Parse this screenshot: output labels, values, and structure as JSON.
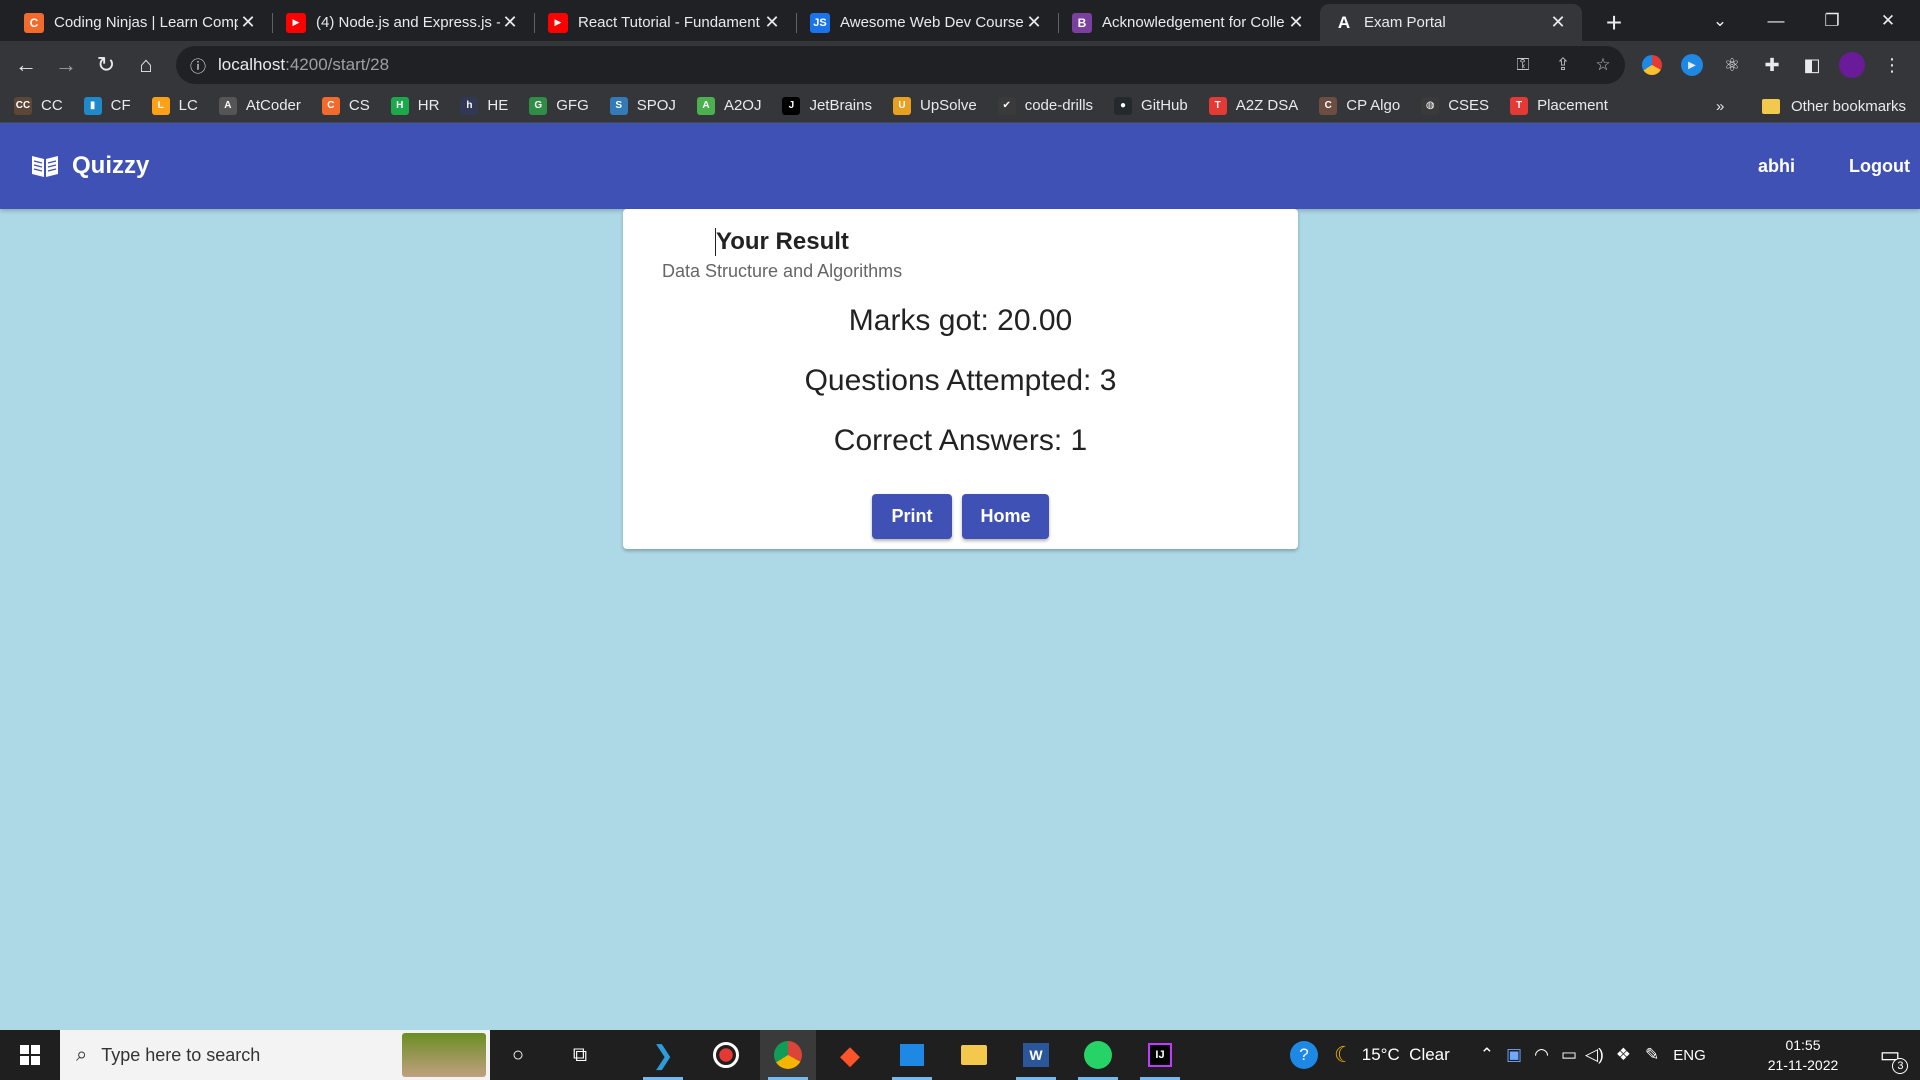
{
  "browser": {
    "tabs": [
      {
        "title": "Coding Ninjas | Learn Comp",
        "icon": "coding-ninjas-icon",
        "color": "#f36b2c"
      },
      {
        "title": "(4) Node.js and Express.js -",
        "icon": "youtube-icon",
        "color": "#ff0000"
      },
      {
        "title": "React Tutorial - Fundament",
        "icon": "youtube-icon",
        "color": "#ff0000"
      },
      {
        "title": "Awesome Web Dev Course",
        "icon": "js-icon",
        "color": "#1a73e8"
      },
      {
        "title": "Acknowledgement for Colle",
        "icon": "document-icon",
        "color": "#7b3fa0"
      },
      {
        "title": "Exam Portal",
        "icon": "angular-icon",
        "color": "#35363a"
      }
    ],
    "url_host": "localhost",
    "url_path": ":4200/start/28",
    "bookmarks": [
      {
        "label": "CC",
        "icon": "codechef-icon",
        "color": "#5b4638",
        "glyph": "CC"
      },
      {
        "label": "CF",
        "icon": "codeforces-icon",
        "color": "#1f8acb",
        "glyph": "▮"
      },
      {
        "label": "LC",
        "icon": "leetcode-icon",
        "color": "#ffa116",
        "glyph": "L"
      },
      {
        "label": "AtCoder",
        "icon": "atcoder-icon",
        "color": "#555555",
        "glyph": "A"
      },
      {
        "label": "CS",
        "icon": "coding-ninjas-icon",
        "color": "#f36b2c",
        "glyph": "C"
      },
      {
        "label": "HR",
        "icon": "hackerrank-icon",
        "color": "#1ba94c",
        "glyph": "H"
      },
      {
        "label": "HE",
        "icon": "hackerearth-icon",
        "color": "#323754",
        "glyph": "h"
      },
      {
        "label": "GFG",
        "icon": "geeksforgeeks-icon",
        "color": "#2f8d46",
        "glyph": "G"
      },
      {
        "label": "SPOJ",
        "icon": "spoj-icon",
        "color": "#337ab7",
        "glyph": "S"
      },
      {
        "label": "A2OJ",
        "icon": "a2oj-icon",
        "color": "#4caf50",
        "glyph": "A"
      },
      {
        "label": "JetBrains",
        "icon": "jetbrains-icon",
        "color": "#000000",
        "glyph": "J"
      },
      {
        "label": "UpSolve",
        "icon": "upsolve-icon",
        "color": "#e8a020",
        "glyph": "U"
      },
      {
        "label": "code-drills",
        "icon": "checkmark-icon",
        "color": "#3a3a3a",
        "glyph": "✔"
      },
      {
        "label": "GitHub",
        "icon": "github-icon",
        "color": "#24292e",
        "glyph": "●"
      },
      {
        "label": "A2Z DSA",
        "icon": "tuf-icon",
        "color": "#e53935",
        "glyph": "T"
      },
      {
        "label": "CP Algo",
        "icon": "cp-algo-icon",
        "color": "#6d4c41",
        "glyph": "C"
      },
      {
        "label": "CSES",
        "icon": "globe-icon",
        "color": "#3a3a3a",
        "glyph": "◍"
      },
      {
        "label": "Placement",
        "icon": "tuf-icon",
        "color": "#e53935",
        "glyph": "T"
      }
    ],
    "bookmarks_overflow": "»",
    "other_bookmarks": "Other bookmarks"
  },
  "app": {
    "brand": "Quizzy",
    "brand_icon": "book-icon",
    "user": "abhi",
    "logout": "Logout",
    "primary_color": "#3f51b5",
    "background_color": "#add8e6"
  },
  "result": {
    "title": "Your Result",
    "subtitle": "Data Structure and Algorithms",
    "marks": "Marks got: 20.00",
    "attempted": "Questions Attempted: 3",
    "correct": "Correct Answers: 1",
    "print_label": "Print",
    "home_label": "Home"
  },
  "taskbar": {
    "search_placeholder": "Type here to search",
    "weather": "15°C  Clear",
    "language": "ENG",
    "time": "01:55",
    "date": "21-11-2022",
    "notifications": "3"
  }
}
